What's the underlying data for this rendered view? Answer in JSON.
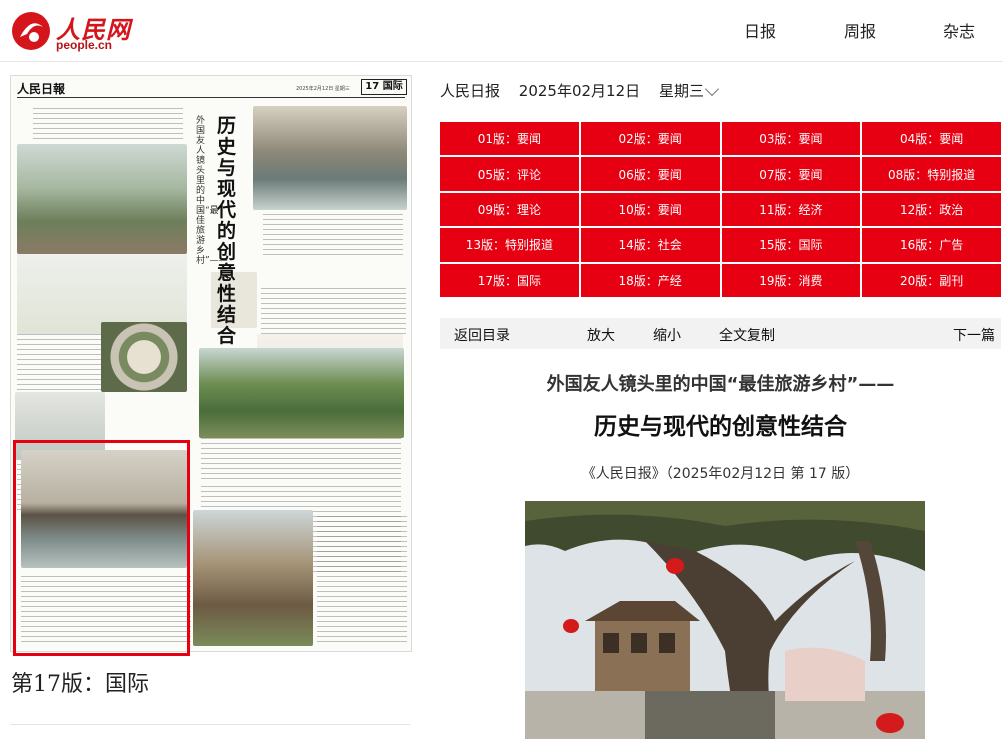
{
  "header": {
    "logo_text": "人民网",
    "logo_url": "people.cn",
    "nav": [
      "日报",
      "周报",
      "杂志"
    ]
  },
  "newspaper": {
    "masthead": "人民日報",
    "date_line": "2025年2月12日 星期三",
    "page_box": "17 国际",
    "vertical_subtitle": "外国友人镜头里的中国“最佳旅游乡村”——",
    "vertical_title": "历史与现代的创意性结合",
    "page_label": "第17版：国际"
  },
  "dateline": {
    "paper": "人民日报",
    "date": "2025年02月12日",
    "weekday": "星期三"
  },
  "editions": [
    "01版：要闻",
    "02版：要闻",
    "03版：要闻",
    "04版：要闻",
    "05版：评论",
    "06版：要闻",
    "07版：要闻",
    "08版：特别报道",
    "09版：理论",
    "10版：要闻",
    "11版：经济",
    "12版：政治",
    "13版：特别报道",
    "14版：社会",
    "15版：国际",
    "16版：广告",
    "17版：国际",
    "18版：产经",
    "19版：消费",
    "20版：副刊"
  ],
  "toolbar": {
    "back": "返回目录",
    "zoom_in": "放大",
    "zoom_out": "缩小",
    "copy_all": "全文复制",
    "next": "下一篇"
  },
  "article": {
    "subtitle": "外国友人镜头里的中国“最佳旅游乡村”——",
    "title": "历史与现代的创意性结合",
    "source": "《人民日报》（2025年02月12日   第 17  版）"
  },
  "colors": {
    "brand_red": "#e60012",
    "logo_red": "#d4161c"
  }
}
